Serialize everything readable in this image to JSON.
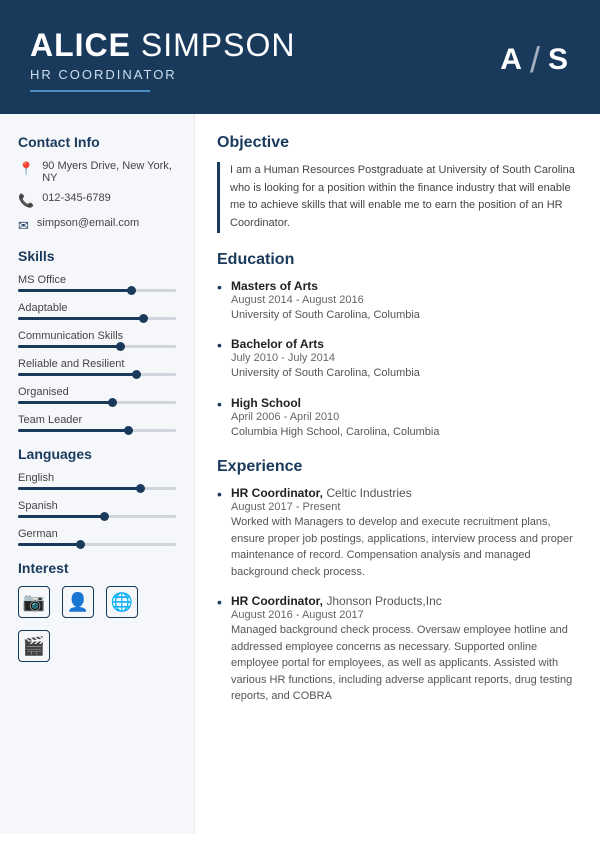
{
  "header": {
    "first_name": "ALICE",
    "last_name": "SIMPSON",
    "title": "HR COORDINATOR",
    "monogram_a": "A",
    "monogram_s": "S"
  },
  "sidebar": {
    "contact_title": "Contact Info",
    "contact": {
      "address": "90 Myers Drive, New York, NY",
      "phone": "012-345-6789",
      "email": "simpson@email.com"
    },
    "skills_title": "Skills",
    "skills": [
      {
        "label": "MS Office",
        "percent": 72
      },
      {
        "label": "Adaptable",
        "percent": 80
      },
      {
        "label": "Communication Skills",
        "percent": 65
      },
      {
        "label": "Reliable and Resilient",
        "percent": 75
      },
      {
        "label": "Organised",
        "percent": 60
      },
      {
        "label": "Team Leader",
        "percent": 70
      }
    ],
    "languages_title": "Languages",
    "languages": [
      {
        "label": "English",
        "percent": 78
      },
      {
        "label": "Spanish",
        "percent": 55
      },
      {
        "label": "German",
        "percent": 40
      }
    ],
    "interest_title": "Interest"
  },
  "content": {
    "objective_title": "Objective",
    "objective_text": "I am a Human Resources Postgraduate at University of South Carolina who is looking for a position within the finance industry that will enable me to achieve skills that will enable me to earn the position of an HR Coordinator.",
    "education_title": "Education",
    "education": [
      {
        "degree": "Masters of Arts",
        "date": "August 2014 - August 2016",
        "institution": "University of South Carolina, Columbia"
      },
      {
        "degree": "Bachelor of Arts",
        "date": "July 2010 - July 2014",
        "institution": "University of South Carolina, Columbia"
      },
      {
        "degree": "High School",
        "date": "April 2006 - April 2010",
        "institution": "Columbia High School, Carolina, Columbia"
      }
    ],
    "experience_title": "Experience",
    "experience": [
      {
        "title": "HR Coordinator",
        "company": "Celtic Industries",
        "date": "August 2017 - Present",
        "description": "Worked with Managers to develop and execute recruitment plans, ensure proper job postings, applications, interview process and proper maintenance of record. Compensation analysis and managed background check process."
      },
      {
        "title": "HR Coordinator",
        "company": "Jhonson Products,Inc",
        "date": "August 2016 - August 2017",
        "description": "Managed background check process. Oversaw employee hotline and addressed employee concerns as necessary. Supported online employee portal for employees, as well as applicants. Assisted with various HR functions, including adverse applicant reports, drug testing reports, and COBRA"
      }
    ]
  }
}
